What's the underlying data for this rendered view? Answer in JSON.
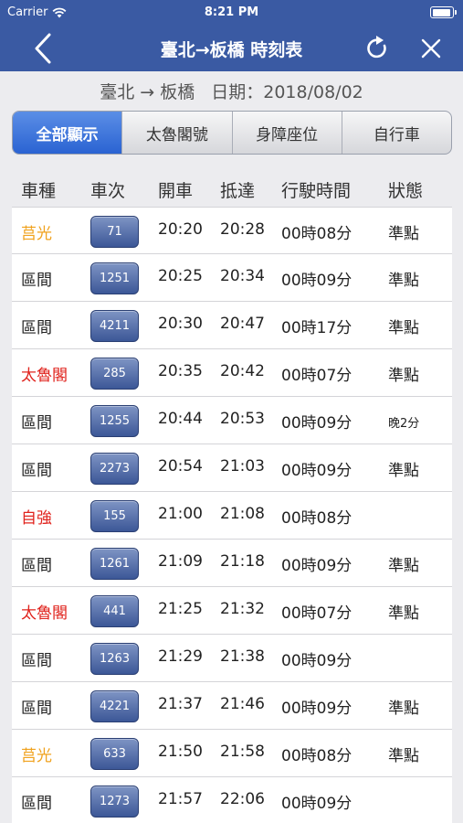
{
  "status_bar": {
    "carrier": "Carrier",
    "time": "8:21 PM"
  },
  "nav": {
    "title": "臺北→板橋 時刻表"
  },
  "subheader": {
    "route": "臺北 → 板橋",
    "date_label": "日期：2018/08/02"
  },
  "segments": [
    {
      "label": "全部顯示",
      "active": true
    },
    {
      "label": "太魯閣號",
      "active": false
    },
    {
      "label": "身障座位",
      "active": false
    },
    {
      "label": "自行車",
      "active": false
    }
  ],
  "columns": [
    "車種",
    "車次",
    "開車",
    "抵達",
    "行駛時間",
    "狀態"
  ],
  "colors": {
    "nav": "#3a5aa3",
    "juguang": "#f0a21e",
    "express": "#e0241e",
    "local": "#222222"
  },
  "trains": [
    {
      "type": "莒光",
      "type_color": "#f0a21e",
      "number": "71",
      "depart": "20:20",
      "arrive": "20:28",
      "duration": "00時08分",
      "status": "準點"
    },
    {
      "type": "區間",
      "type_color": "#222222",
      "number": "1251",
      "depart": "20:25",
      "arrive": "20:34",
      "duration": "00時09分",
      "status": "準點"
    },
    {
      "type": "區間",
      "type_color": "#222222",
      "number": "4211",
      "depart": "20:30",
      "arrive": "20:47",
      "duration": "00時17分",
      "status": "準點"
    },
    {
      "type": "太魯閣",
      "type_color": "#e0241e",
      "number": "285",
      "depart": "20:35",
      "arrive": "20:42",
      "duration": "00時07分",
      "status": "準點"
    },
    {
      "type": "區間",
      "type_color": "#222222",
      "number": "1255",
      "depart": "20:44",
      "arrive": "20:53",
      "duration": "00時09分",
      "status": "晚2分"
    },
    {
      "type": "區間",
      "type_color": "#222222",
      "number": "2273",
      "depart": "20:54",
      "arrive": "21:03",
      "duration": "00時09分",
      "status": "準點"
    },
    {
      "type": "自強",
      "type_color": "#e0241e",
      "number": "155",
      "depart": "21:00",
      "arrive": "21:08",
      "duration": "00時08分",
      "status": ""
    },
    {
      "type": "區間",
      "type_color": "#222222",
      "number": "1261",
      "depart": "21:09",
      "arrive": "21:18",
      "duration": "00時09分",
      "status": "準點"
    },
    {
      "type": "太魯閣",
      "type_color": "#e0241e",
      "number": "441",
      "depart": "21:25",
      "arrive": "21:32",
      "duration": "00時07分",
      "status": "準點"
    },
    {
      "type": "區間",
      "type_color": "#222222",
      "number": "1263",
      "depart": "21:29",
      "arrive": "21:38",
      "duration": "00時09分",
      "status": ""
    },
    {
      "type": "區間",
      "type_color": "#222222",
      "number": "4221",
      "depart": "21:37",
      "arrive": "21:46",
      "duration": "00時09分",
      "status": "準點"
    },
    {
      "type": "莒光",
      "type_color": "#f0a21e",
      "number": "633",
      "depart": "21:50",
      "arrive": "21:58",
      "duration": "00時08分",
      "status": "準點"
    },
    {
      "type": "區間",
      "type_color": "#222222",
      "number": "1273",
      "depart": "21:57",
      "arrive": "22:06",
      "duration": "00時09分",
      "status": ""
    }
  ]
}
